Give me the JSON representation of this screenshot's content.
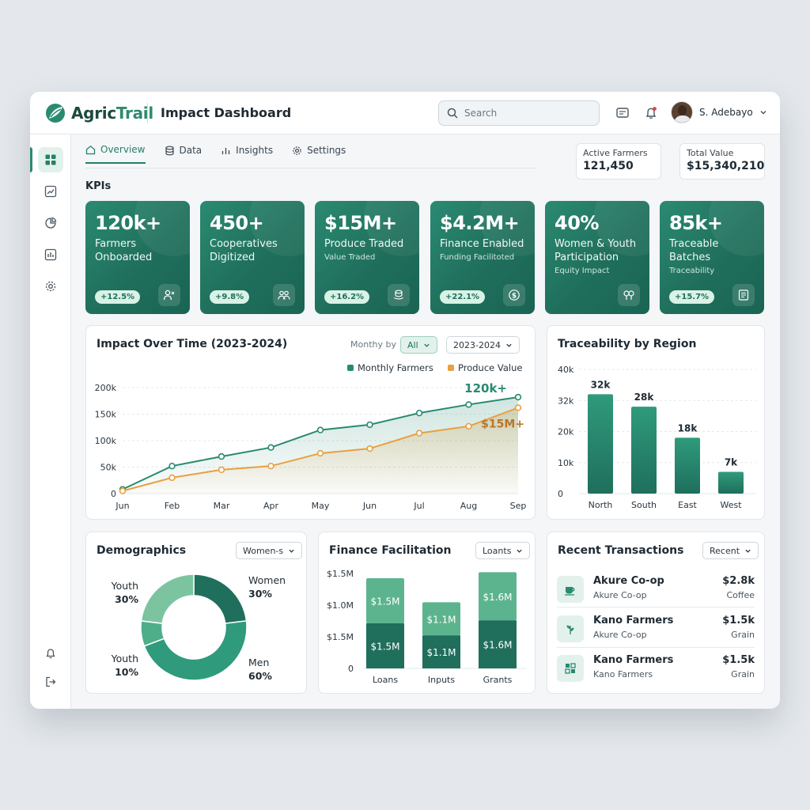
{
  "app": {
    "logo_prefix": "Agric",
    "logo_suffix": "Trail",
    "page_title": "Impact Dashboard",
    "search_placeholder": "Search",
    "user_name": "S. Adebayo"
  },
  "colors": {
    "brand_dark": "#1f6f5c",
    "brand": "#2a8a70",
    "accent_orange": "#e8a040",
    "bar_light": "#5cb48e",
    "bar_dark": "#1f6f5c"
  },
  "sidebar": {
    "icons": [
      "dashboard-icon",
      "trend-icon",
      "pie-chart-icon",
      "bar-chart-icon",
      "gear-icon"
    ],
    "bottom_icons": [
      "bell-icon",
      "logout-icon"
    ]
  },
  "tabs": [
    {
      "label": "Overview",
      "icon": "home-icon",
      "active": true
    },
    {
      "label": "Data",
      "icon": "database-icon",
      "active": false
    },
    {
      "label": "Insights",
      "icon": "bar-chart-icon",
      "active": false
    },
    {
      "label": "Settings",
      "icon": "gear-icon",
      "active": false
    }
  ],
  "stats": {
    "active_farmers": {
      "label": "Active Farmers",
      "value": "121,450"
    },
    "total_value": {
      "label": "Total Value",
      "value": "$15,340,210"
    }
  },
  "kpi_heading": "KPIs",
  "kpis": [
    {
      "value": "120k+",
      "label": "Farmers Onboarded",
      "sub": "",
      "badge": "+12.5%",
      "icon": "users-icon"
    },
    {
      "value": "450+",
      "label": "Cooperatives Digitized",
      "sub": "",
      "badge": "+9.8%",
      "icon": "group-icon"
    },
    {
      "value": "$15M+",
      "label": "Produce Traded",
      "sub": "Value Traded",
      "badge": "+16.2%",
      "icon": "coins-icon"
    },
    {
      "value": "$4.2M+",
      "label": "Finance Enabled",
      "sub": "Funding Facilitoted",
      "badge": "+22.1%",
      "icon": "dollar-icon"
    },
    {
      "value": "40%",
      "label": "Women & Youth Participation",
      "sub": "Equity Impact",
      "badge": "",
      "icon": "gender-icon"
    },
    {
      "value": "85k+",
      "label": "Traceable Batches",
      "sub": "Traceability",
      "badge": "+15.7%",
      "icon": "ledger-icon"
    }
  ],
  "impact_card": {
    "title": "Impact Over Time (2023-2024)",
    "monthly_by": "Monthy by",
    "filter_value": "All",
    "range_value": "2023-2024"
  },
  "region_card": {
    "title": "Traceability by Region"
  },
  "demographics_card": {
    "title": "Demographics",
    "select": "Women-s"
  },
  "finance_card": {
    "title": "Finance Facilitation",
    "select": "Loants"
  },
  "transactions_card": {
    "title": "Recent Transactions",
    "select": "Recent",
    "rows": [
      {
        "name": "Akure Co-op",
        "sub": "Akure Co-op",
        "amount": "$2.8k",
        "category": "Coffee",
        "icon": "coffee-icon"
      },
      {
        "name": "Kano Farmers",
        "sub": "Akure Co-op",
        "amount": "$1.5k",
        "category": "Grain",
        "icon": "leaf-icon"
      },
      {
        "name": "Kano Farmers",
        "sub": "Kano Farmers",
        "amount": "$1.5k",
        "category": "Grain",
        "icon": "grid-icon"
      }
    ]
  },
  "chart_data": [
    {
      "type": "line",
      "title": "Impact Over Time (2023-2024)",
      "x": [
        "Jun",
        "Feb",
        "Mar",
        "Apr",
        "May",
        "Jun",
        "Jul",
        "Aug",
        "Sep"
      ],
      "ylim": [
        0,
        200000
      ],
      "yticks": [
        "0",
        "50k",
        "100k",
        "150k",
        "200k"
      ],
      "legend_position": "top-right",
      "series": [
        {
          "name": "Monthly Farmers",
          "color": "#2a8a70",
          "values": [
            8000,
            52000,
            70000,
            87000,
            120000,
            130000,
            152000,
            168000,
            182000
          ],
          "end_label": "120k+"
        },
        {
          "name": "Produce Value",
          "color": "#e8a040",
          "values": [
            5000,
            30000,
            45000,
            52000,
            76000,
            85000,
            114000,
            127000,
            162000
          ],
          "end_label": "$15M+"
        }
      ]
    },
    {
      "type": "bar",
      "title": "Traceability by Region",
      "categories": [
        "North",
        "South",
        "East",
        "West"
      ],
      "values": [
        32000,
        28000,
        18000,
        7000
      ],
      "labels": [
        "32k",
        "28k",
        "18k",
        "7k"
      ],
      "ylim": [
        0,
        40000
      ],
      "yticks": [
        "0",
        "10k",
        "20k",
        "32k",
        "40k"
      ]
    },
    {
      "type": "pie",
      "title": "Demographics",
      "slices": [
        {
          "name": "Women",
          "value": 30,
          "label": "30%",
          "color": "#1f6f5c"
        },
        {
          "name": "Men",
          "value": 60,
          "label": "60%",
          "color": "#2f9a7c"
        },
        {
          "name": "Youth",
          "value": 10,
          "label": "10%",
          "color": "#4fae8a"
        },
        {
          "name": "Youth",
          "value": 30,
          "label": "30%",
          "color": "#7cc49f"
        }
      ]
    },
    {
      "type": "bar",
      "title": "Finance Facilitation",
      "categories": [
        "Loans",
        "Inputs",
        "Grants"
      ],
      "yticks": [
        "0",
        "$1.5M",
        "$1.0M",
        "$1.5M"
      ],
      "series": [
        {
          "name": "lower",
          "values": [
            1.5,
            1.1,
            1.6
          ],
          "labels": [
            "$1.5M",
            "$1.1M",
            "$1.6M"
          ],
          "color": "#1f6f5c"
        },
        {
          "name": "upper",
          "values": [
            1.5,
            1.1,
            1.6
          ],
          "labels": [
            "$1.5M",
            "$1.1M",
            "$1.6M"
          ],
          "color": "#5cb48e"
        }
      ]
    }
  ]
}
